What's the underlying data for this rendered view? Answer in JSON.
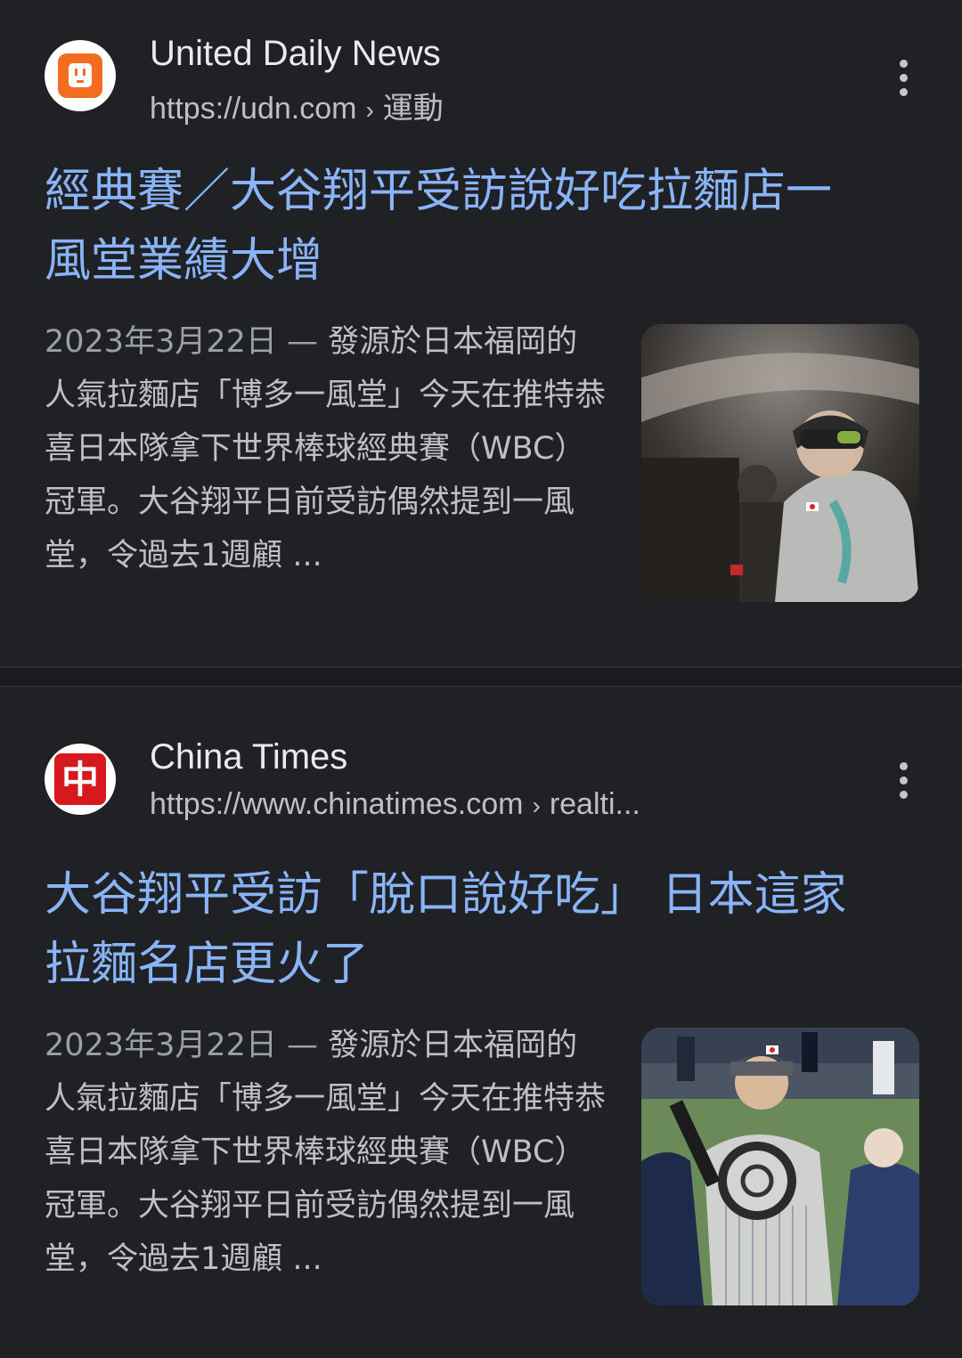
{
  "results": [
    {
      "site_name": "United Daily News",
      "url": "https://udn.com",
      "url_separator": "›",
      "url_path": "運動",
      "favicon_icon": "udn-logo-icon",
      "favicon_color": "#f36c21",
      "title_line1": "經典賽／大谷翔平受訪說好吃拉麵店一",
      "title_line2": "風堂業績大增",
      "date": "2023年3月22日",
      "date_dash": "—",
      "snippet": "發源於日本福岡的人氣拉麵店「博多一風堂」今天在推特恭喜日本隊拿下世界棒球經典賽（WBC）冠軍。大谷翔平日前受訪偶然提到一風堂，令過去1週顧 ...",
      "thumbnail_desc": "player-celebration-thumbnail"
    },
    {
      "site_name": "China Times",
      "url": "https://www.chinatimes.com",
      "url_separator": "›",
      "url_path": "realti...",
      "favicon_icon": "chinatimes-logo-icon",
      "favicon_color": "#d7191d",
      "favicon_text": "中",
      "title_line1": "大谷翔平受訪「脫口說好吃」 日本這家",
      "title_line2": "拉麵名店更火了",
      "date": "2023年3月22日",
      "date_dash": "—",
      "snippet": "發源於日本福岡的人氣拉麵店「博多一風堂」今天在推特恭喜日本隊拿下世界棒球經典賽（WBC）冠軍。大谷翔平日前受訪偶然提到一風堂，令過去1週顧 ...",
      "thumbnail_desc": "trophy-ceremony-thumbnail"
    }
  ]
}
